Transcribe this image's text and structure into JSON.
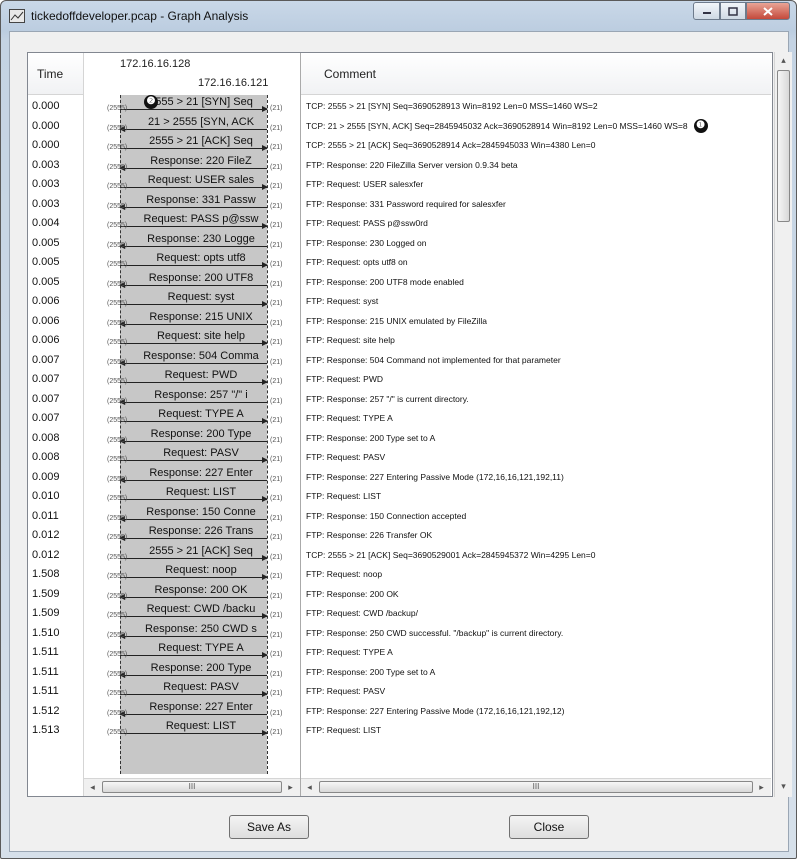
{
  "window": {
    "title": "tickedoffdeveloper.pcap - Graph Analysis",
    "min_icon": "minimize-icon",
    "max_icon": "maximize-icon",
    "close_icon": "close-icon"
  },
  "columns": {
    "time": "Time",
    "comment": "Comment"
  },
  "hosts": {
    "left": "172.16.16.128",
    "right": "172.16.16.121"
  },
  "markers": {
    "graph": "❷",
    "comment": "❶"
  },
  "ports": {
    "client": "(2555)",
    "server": "(21)"
  },
  "rows": [
    {
      "time": "0.000",
      "label": "2555 > 21 [SYN] Seq",
      "dir": "right",
      "comment": "TCP: 2555 > 21 [SYN] Seq=3690528913 Win=8192 Len=0 MSS=1460 WS=2"
    },
    {
      "time": "0.000",
      "label": "21 > 2555 [SYN, ACK",
      "dir": "left",
      "comment": "TCP: 21 > 2555 [SYN, ACK] Seq=2845945032 Ack=3690528914 Win=8192 Len=0 MSS=1460 WS=8"
    },
    {
      "time": "0.000",
      "label": "2555 > 21 [ACK] Seq",
      "dir": "right",
      "comment": "TCP: 2555 > 21 [ACK] Seq=3690528914 Ack=2845945033 Win=4380 Len=0"
    },
    {
      "time": "0.003",
      "label": "Response: 220 FileZ",
      "dir": "left",
      "comment": "FTP: Response: 220 FileZilla Server version 0.9.34 beta"
    },
    {
      "time": "0.003",
      "label": "Request: USER sales",
      "dir": "right",
      "comment": "FTP: Request: USER salesxfer"
    },
    {
      "time": "0.003",
      "label": "Response: 331 Passw",
      "dir": "left",
      "comment": "FTP: Response: 331 Password required for salesxfer"
    },
    {
      "time": "0.004",
      "label": "Request: PASS p@ssw",
      "dir": "right",
      "comment": "FTP: Request: PASS p@ssw0rd"
    },
    {
      "time": "0.005",
      "label": "Response: 230 Logge",
      "dir": "left",
      "comment": "FTP: Response: 230 Logged on"
    },
    {
      "time": "0.005",
      "label": "Request: opts utf8",
      "dir": "right",
      "comment": "FTP: Request: opts utf8 on"
    },
    {
      "time": "0.005",
      "label": "Response: 200 UTF8",
      "dir": "left",
      "comment": "FTP: Response: 200 UTF8 mode enabled"
    },
    {
      "time": "0.006",
      "label": "Request: syst",
      "dir": "right",
      "comment": "FTP: Request: syst"
    },
    {
      "time": "0.006",
      "label": "Response: 215 UNIX",
      "dir": "left",
      "comment": "FTP: Response: 215 UNIX emulated by FileZilla"
    },
    {
      "time": "0.006",
      "label": "Request: site help",
      "dir": "right",
      "comment": "FTP: Request: site help"
    },
    {
      "time": "0.007",
      "label": "Response: 504 Comma",
      "dir": "left",
      "comment": "FTP: Response: 504 Command not implemented for that parameter"
    },
    {
      "time": "0.007",
      "label": "Request: PWD",
      "dir": "right",
      "comment": "FTP: Request: PWD"
    },
    {
      "time": "0.007",
      "label": "Response: 257 \"/\" i",
      "dir": "left",
      "comment": "FTP: Response: 257 \"/\" is current directory."
    },
    {
      "time": "0.007",
      "label": "Request: TYPE A",
      "dir": "right",
      "comment": "FTP: Request: TYPE A"
    },
    {
      "time": "0.008",
      "label": "Response: 200 Type",
      "dir": "left",
      "comment": "FTP: Response: 200 Type set to A"
    },
    {
      "time": "0.008",
      "label": "Request: PASV",
      "dir": "right",
      "comment": "FTP: Request: PASV"
    },
    {
      "time": "0.009",
      "label": "Response: 227 Enter",
      "dir": "left",
      "comment": "FTP: Response: 227 Entering Passive Mode (172,16,16,121,192,11)"
    },
    {
      "time": "0.010",
      "label": "Request: LIST",
      "dir": "right",
      "comment": "FTP: Request: LIST"
    },
    {
      "time": "0.011",
      "label": "Response: 150 Conne",
      "dir": "left",
      "comment": "FTP: Response: 150 Connection accepted"
    },
    {
      "time": "0.012",
      "label": "Response: 226 Trans",
      "dir": "left",
      "comment": "FTP: Response: 226 Transfer OK"
    },
    {
      "time": "0.012",
      "label": "2555 > 21 [ACK] Seq",
      "dir": "right",
      "comment": "TCP: 2555 > 21 [ACK] Seq=3690529001 Ack=2845945372 Win=4295 Len=0"
    },
    {
      "time": "1.508",
      "label": "Request: noop",
      "dir": "right",
      "comment": "FTP: Request: noop"
    },
    {
      "time": "1.509",
      "label": "Response: 200 OK",
      "dir": "left",
      "comment": "FTP: Response: 200 OK"
    },
    {
      "time": "1.509",
      "label": "Request: CWD /backu",
      "dir": "right",
      "comment": "FTP: Request: CWD /backup/"
    },
    {
      "time": "1.510",
      "label": "Response: 250 CWD s",
      "dir": "left",
      "comment": "FTP: Response: 250 CWD successful. \"/backup\" is current directory."
    },
    {
      "time": "1.511",
      "label": "Request: TYPE A",
      "dir": "right",
      "comment": "FTP: Request: TYPE A"
    },
    {
      "time": "1.511",
      "label": "Response: 200 Type",
      "dir": "left",
      "comment": "FTP: Response: 200 Type set to A"
    },
    {
      "time": "1.511",
      "label": "Request: PASV",
      "dir": "right",
      "comment": "FTP: Request: PASV"
    },
    {
      "time": "1.512",
      "label": "Response: 227 Enter",
      "dir": "left",
      "comment": "FTP: Response: 227 Entering Passive Mode (172,16,16,121,192,12)"
    },
    {
      "time": "1.513",
      "label": "Request: LIST",
      "dir": "right",
      "comment": "FTP: Request: LIST"
    }
  ],
  "scroll": {
    "left_arrow": "◂",
    "right_arrow": "▸",
    "up_arrow": "▴",
    "down_arrow": "▾",
    "grip": "III"
  },
  "buttons": {
    "save_as": "Save As",
    "close": "Close"
  }
}
